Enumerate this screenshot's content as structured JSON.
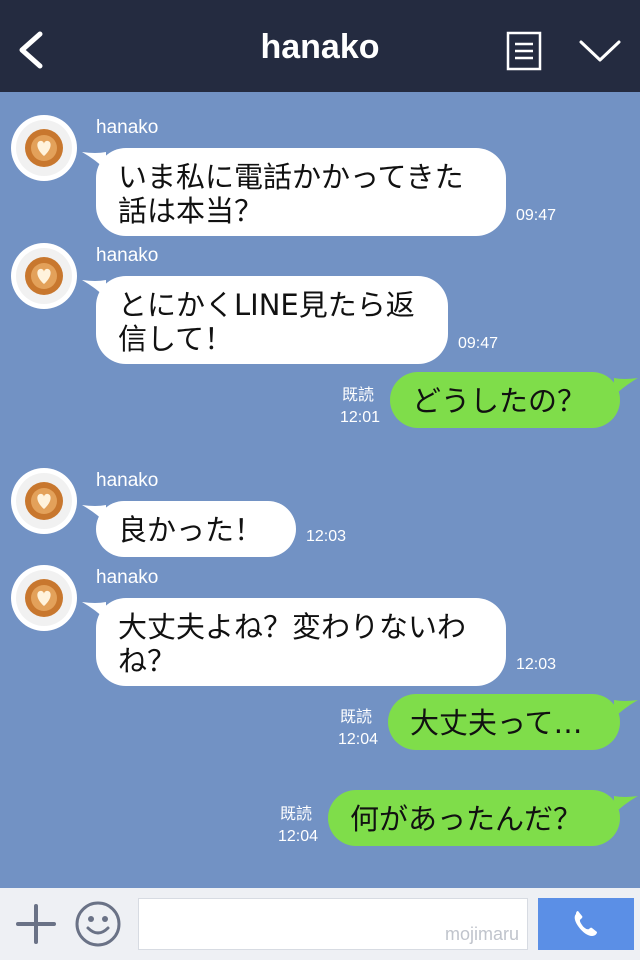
{
  "header": {
    "title": "hanako"
  },
  "messages": [
    {
      "sender": "hanako",
      "text": "いま私に電話かかってきた\n話は本当？",
      "time": "09:47"
    },
    {
      "sender": "hanako",
      "text": "とにかくLINE見たら返\n信して！",
      "time": "09:47"
    },
    {
      "outgoing": true,
      "text": "どうしたの？",
      "read": "既読",
      "time": "12:01"
    },
    {
      "sender": "hanako",
      "text": "良かった！",
      "time": "12:03"
    },
    {
      "sender": "hanako",
      "text": "大丈夫よね？変わりないわ\nね？",
      "time": "12:03"
    },
    {
      "outgoing": true,
      "text": "大丈夫って…",
      "read": "既読",
      "time": "12:04"
    },
    {
      "outgoing": true,
      "text": "何があったんだ？",
      "read": "既読",
      "time": "12:04"
    }
  ],
  "footer": {
    "watermark": "mojimaru"
  },
  "colors": {
    "header_bg": "#242b40",
    "chat_bg": "#7292c4",
    "incoming_bubble": "#ffffff",
    "outgoing_bubble": "#7fdd4a",
    "call_button": "#5b8fe6"
  }
}
